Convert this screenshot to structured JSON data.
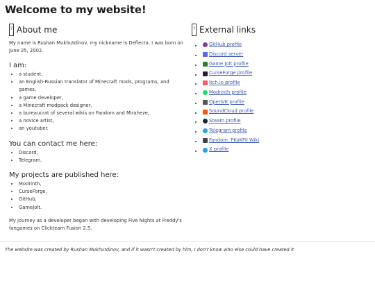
{
  "page": {
    "title": "Welcome to my website!"
  },
  "about": {
    "heading": "About me",
    "intro": "My name is Rushan Mukhutdinov, my nickname is Deflecta. I was born on June 25, 2002.",
    "iam_heading": "I am:",
    "iam_items": [
      "a student,",
      "an English-Russian translator of Minecraft mods, programs, and games,",
      "a game developer,",
      "a Minecraft modpack designer,",
      "a bureaucrat of several wikis on Fandom and Miraheze,",
      "a novice artist,",
      "an youtuber."
    ],
    "contact_heading": "You can contact me here:",
    "contact_items": [
      "Discord,",
      "Telegram."
    ],
    "projects_heading": "My projects are published here:",
    "projects_items": [
      "Modrinth,",
      "CurseForge,",
      "GitHub,",
      "GameJolt."
    ],
    "journey": "My journey as a developer began with developing Five Nights at Freddy's fangames on Clickteam Fusion 2.5."
  },
  "external": {
    "heading": "External links",
    "links": [
      {
        "label": "GitHub profile",
        "icon": "github-icon",
        "color": "#7b3fa0"
      },
      {
        "label": "Discord server",
        "icon": "discord-icon",
        "color": "#5865f2"
      },
      {
        "label": "Game Jolt profile",
        "icon": "gamejolt-icon",
        "color": "#2f7f2f"
      },
      {
        "label": "CurseForge profile",
        "icon": "curseforge-icon",
        "color": "#222222"
      },
      {
        "label": "Itch.io profile",
        "icon": "itchio-icon",
        "color": "#fa5c5c"
      },
      {
        "label": "Modrinth profile",
        "icon": "modrinth-icon",
        "color": "#1bd96a"
      },
      {
        "label": "OpenVK profile",
        "icon": "openvk-icon",
        "color": "#555555"
      },
      {
        "label": "SoundCloud profile",
        "icon": "soundcloud-icon",
        "color": "#ff5500"
      },
      {
        "label": "Steam profile",
        "icon": "steam-icon",
        "color": "#1b2838"
      },
      {
        "label": "Telegram profile",
        "icon": "telegram-icon",
        "color": "#2aa3df"
      },
      {
        "label": "Fandom: FKoKFII Wiki",
        "icon": "fandom-icon",
        "color": "#444444"
      },
      {
        "label": "X profile",
        "icon": "x-icon",
        "color": "#1da1f2"
      }
    ]
  },
  "footer": {
    "text": "The website was created by Rushan Mukhutdinov, and if it wasn't created by him, I don't know who else could have created it"
  }
}
